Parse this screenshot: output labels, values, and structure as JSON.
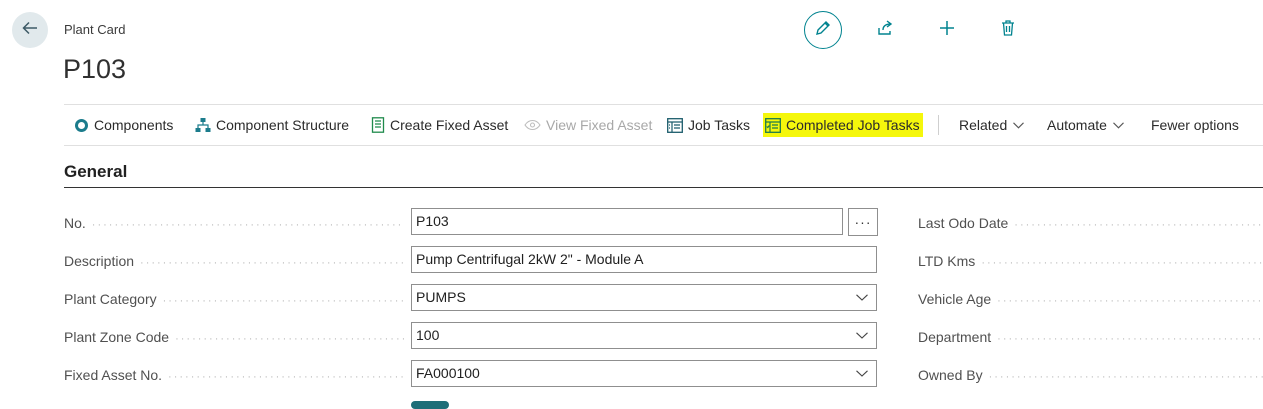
{
  "header": {
    "breadcrumb": "Plant Card",
    "title": "P103"
  },
  "top_actions": [
    {
      "name": "edit",
      "icon": "pencil-icon"
    },
    {
      "name": "share",
      "icon": "share-icon"
    },
    {
      "name": "new",
      "icon": "plus-icon"
    },
    {
      "name": "delete",
      "icon": "trash-icon"
    }
  ],
  "action_bar": {
    "components": "Components",
    "component_structure": "Component Structure",
    "create_fixed_asset": "Create Fixed Asset",
    "view_fixed_asset": "View Fixed Asset",
    "job_tasks": "Job Tasks",
    "completed_job_tasks": "Completed Job Tasks",
    "related": "Related",
    "automate": "Automate",
    "fewer_options": "Fewer options"
  },
  "section": {
    "title": "General"
  },
  "fields": [
    {
      "label": "No.",
      "value": "P103",
      "type": "text-assist"
    },
    {
      "label": "Description",
      "value": "Pump Centrifugal 2kW 2\" - Module A",
      "type": "text"
    },
    {
      "label": "Plant Category",
      "value": "PUMPS",
      "type": "select"
    },
    {
      "label": "Plant Zone Code",
      "value": "100",
      "type": "select"
    },
    {
      "label": "Fixed Asset No.",
      "value": "FA000100",
      "type": "select"
    }
  ],
  "assist_button": "···",
  "right_fields": [
    {
      "label": "Last Odo Date"
    },
    {
      "label": "LTD Kms"
    },
    {
      "label": "Vehicle Age"
    },
    {
      "label": "Department"
    },
    {
      "label": "Owned By"
    }
  ],
  "colors": {
    "accent": "#00838f",
    "highlight": "#f5f70c",
    "icon_green": "#1f8a4c"
  }
}
